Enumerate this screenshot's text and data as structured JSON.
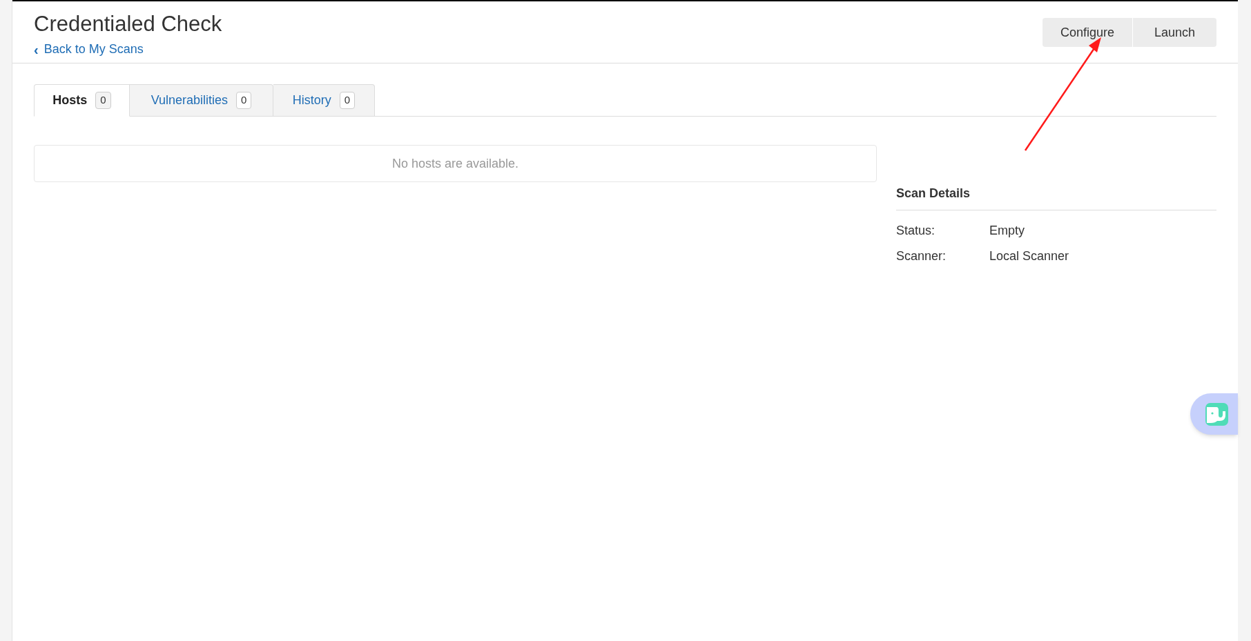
{
  "header": {
    "title": "Credentialed Check",
    "back_link": {
      "icon": "‹",
      "label": "Back to My Scans"
    }
  },
  "actions": [
    {
      "label": "Configure"
    },
    {
      "label": "Launch"
    }
  ],
  "tabs": [
    {
      "label": "Hosts",
      "count": "0",
      "selected": true
    },
    {
      "label": "Vulnerabilities",
      "count": "0",
      "selected": false
    },
    {
      "label": "History",
      "count": "0",
      "selected": false
    }
  ],
  "hosts_panel": {
    "empty_message": "No hosts are available."
  },
  "scan_details": {
    "title": "Scan Details",
    "rows": [
      {
        "label": "Status:",
        "value": "Empty"
      },
      {
        "label": "Scanner:",
        "value": "Local Scanner"
      }
    ]
  }
}
